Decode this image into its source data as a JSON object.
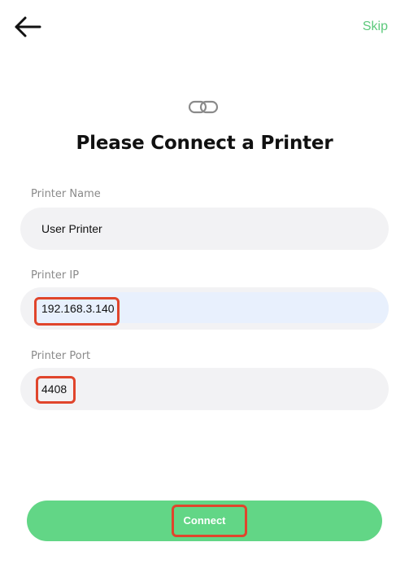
{
  "header": {
    "back_icon": "arrow-left-icon",
    "skip_label": "Skip",
    "accent_color": "#5dc97c"
  },
  "hero": {
    "icon": "link-icon",
    "title": "Please Connect a Printer"
  },
  "form": {
    "printer_name": {
      "label": "Printer Name",
      "value": "User Printer"
    },
    "printer_ip": {
      "label": "Printer IP",
      "value": "192.168.3.140"
    },
    "printer_port": {
      "label": "Printer Port",
      "value": "4408"
    }
  },
  "footer": {
    "connect_label": "Connect",
    "button_color": "#62d686"
  },
  "annotations": {
    "highlight_color": "#e0452c"
  }
}
